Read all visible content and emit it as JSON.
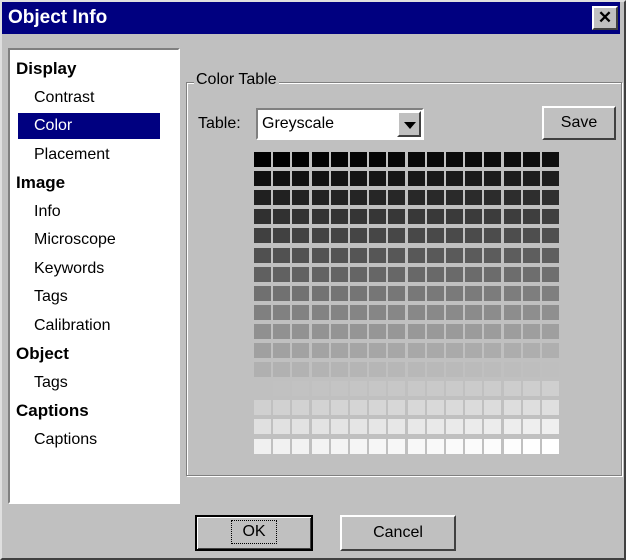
{
  "window": {
    "title": "Object Info"
  },
  "tree": {
    "items": [
      {
        "label": "Display",
        "kind": "category"
      },
      {
        "label": "Contrast",
        "kind": "item"
      },
      {
        "label": "Color",
        "kind": "item",
        "selected": true
      },
      {
        "label": "Placement",
        "kind": "item"
      },
      {
        "label": "Image",
        "kind": "category"
      },
      {
        "label": "Info",
        "kind": "item"
      },
      {
        "label": "Microscope",
        "kind": "item"
      },
      {
        "label": "Keywords",
        "kind": "item"
      },
      {
        "label": "Tags",
        "kind": "item"
      },
      {
        "label": "Calibration",
        "kind": "item"
      },
      {
        "label": "Object",
        "kind": "category"
      },
      {
        "label": "Tags",
        "kind": "item"
      },
      {
        "label": "Captions",
        "kind": "category"
      },
      {
        "label": "Captions",
        "kind": "item"
      }
    ]
  },
  "color_table": {
    "group_label": "Color Table",
    "table_label": "Table:",
    "selected_table": "Greyscale",
    "save_label": "Save",
    "swatch_rows": 16,
    "swatch_cols": 16,
    "palette": "greyscale",
    "start_color": "#000000",
    "end_color": "#ffffff"
  },
  "buttons": {
    "ok": "OK",
    "cancel": "Cancel"
  },
  "colors": {
    "titlebar": "#000080",
    "selection": "#000080",
    "face": "#c0c0c0"
  }
}
